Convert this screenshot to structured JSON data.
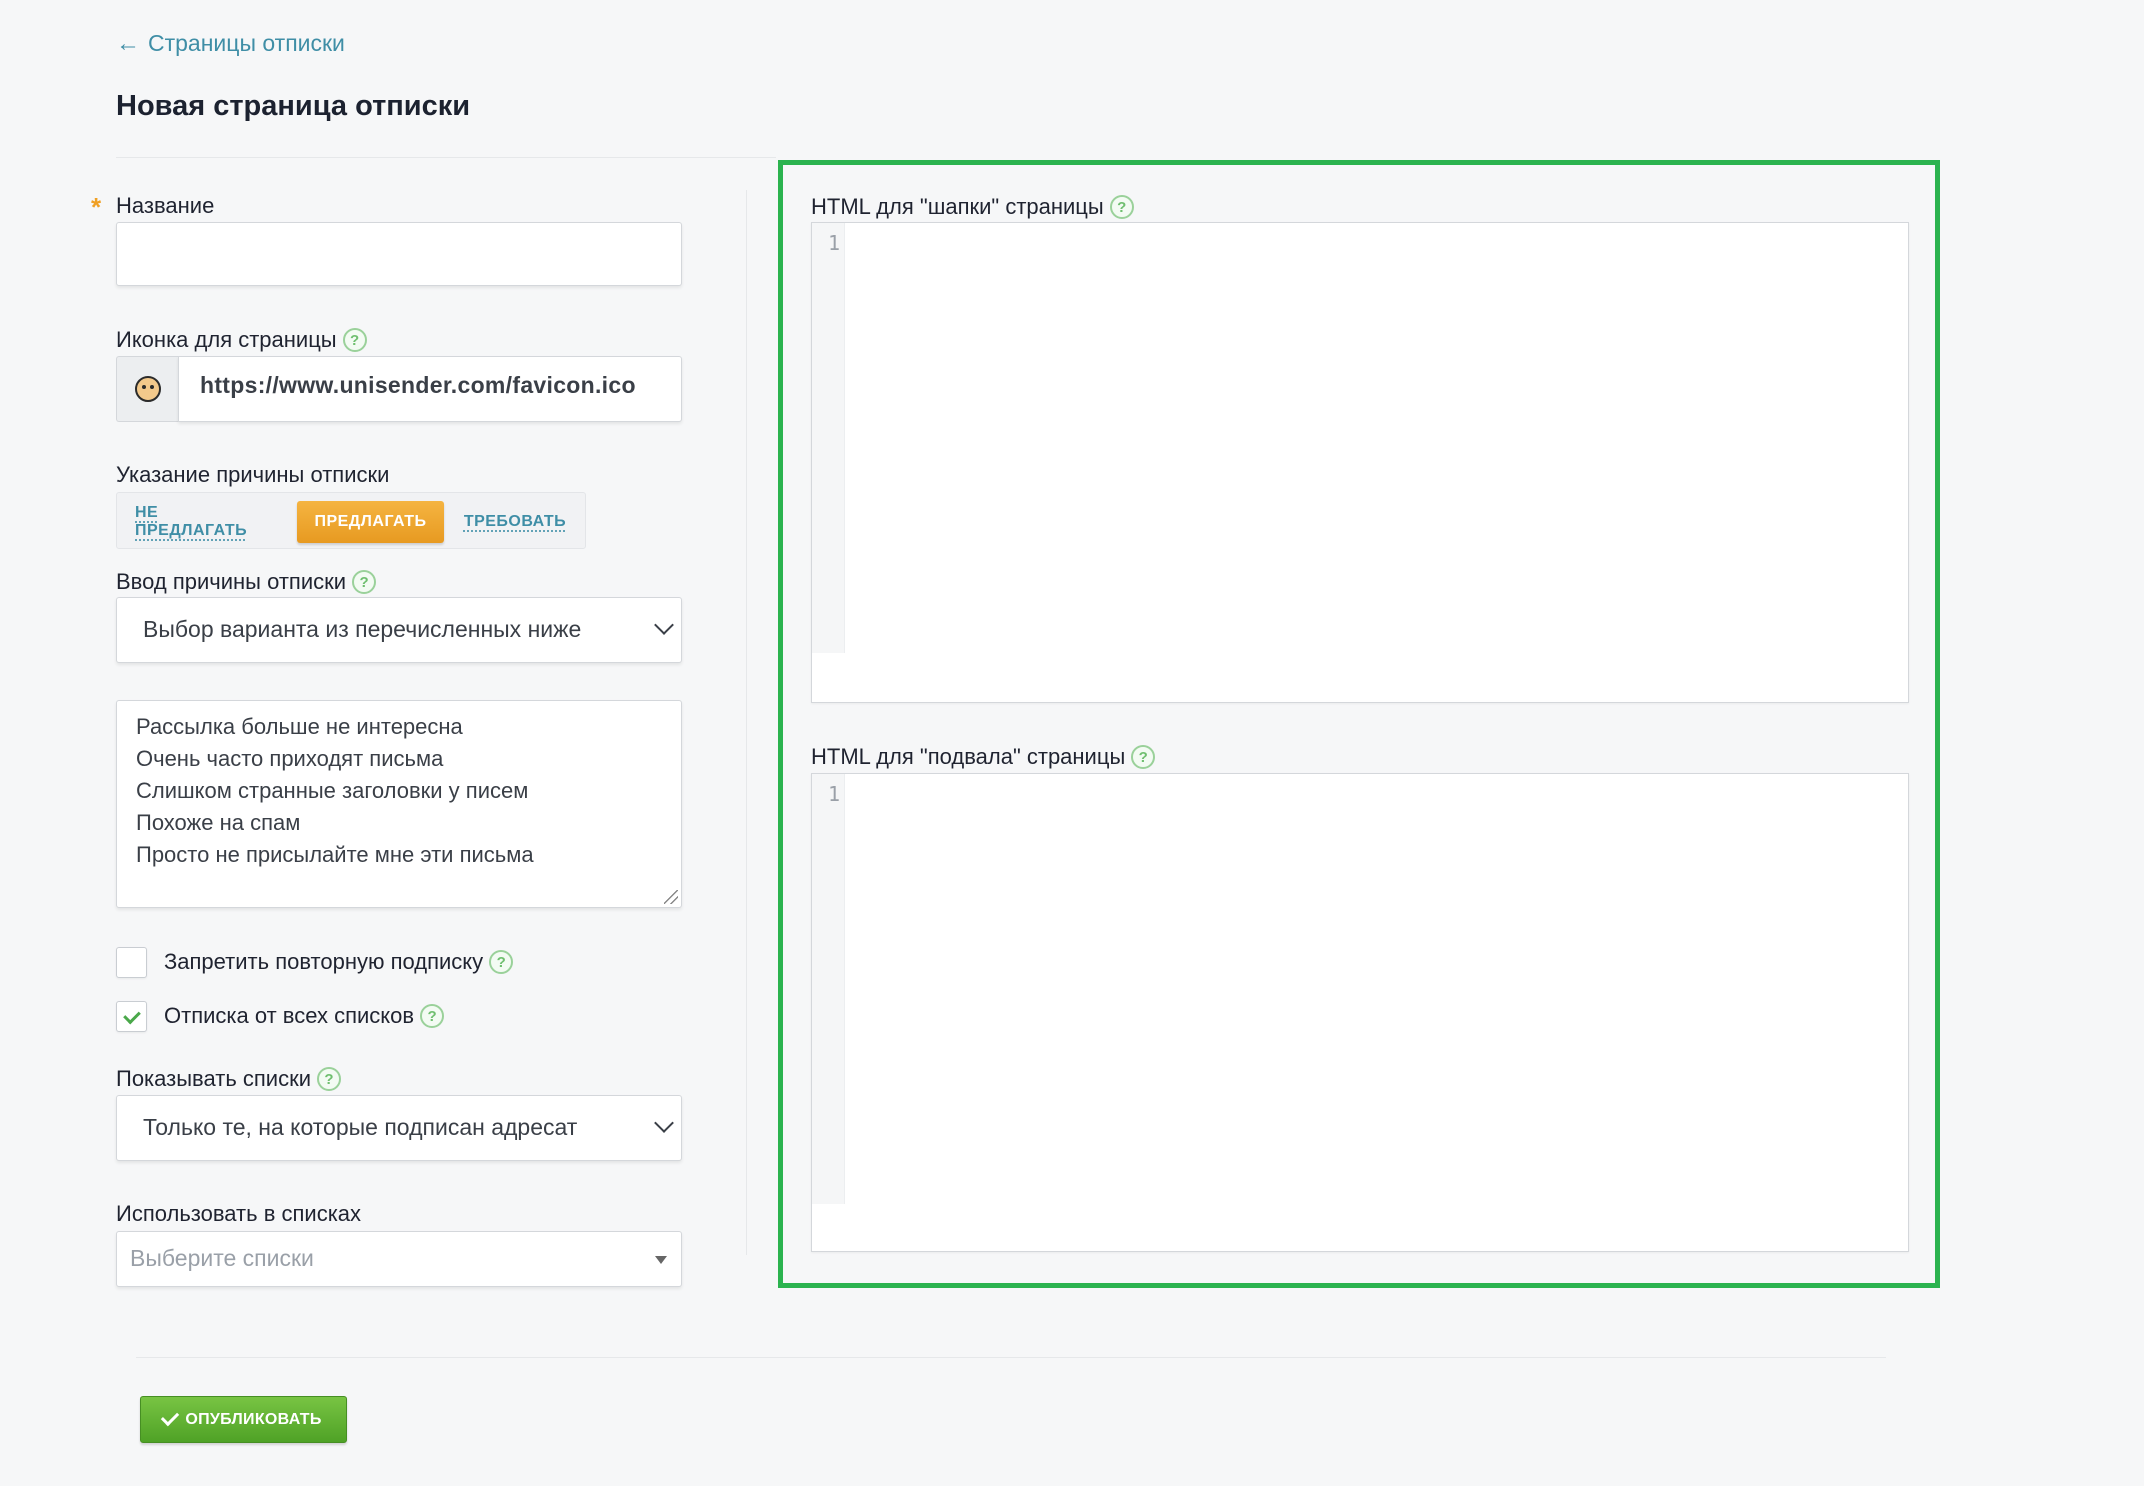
{
  "nav": {
    "back_arrow": "←",
    "back_label": "Страницы отписки"
  },
  "page": {
    "title": "Новая страница отписки"
  },
  "form": {
    "name": {
      "label": "Название",
      "required_mark": "*",
      "value": ""
    },
    "icon": {
      "label": "Иконка для страницы",
      "help": "?",
      "value": "https://www.unisender.com/favicon.ico",
      "preview_icon": "favicon-icon"
    },
    "reason": {
      "label": "Указание причины отписки",
      "options": [
        "НЕ ПРЕДЛАГАТЬ",
        "ПРЕДЛАГАТЬ",
        "ТРЕБОВАТЬ"
      ],
      "selected": "ПРЕДЛАГАТЬ"
    },
    "reason_input": {
      "label": "Ввод причины отписки",
      "help": "?",
      "selected": "Выбор варианта из перечисленных ниже"
    },
    "reasons_list": [
      "Рассылка больше не интересна",
      "Очень часто приходят письма",
      "Слишком странные заголовки у писем",
      "Похоже на спам",
      "Просто не присылайте мне эти письма"
    ],
    "forbid_resubscribe": {
      "label": "Запретить повторную подписку",
      "help": "?",
      "checked": false
    },
    "unsubscribe_all": {
      "label": "Отписка от всех списков",
      "help": "?",
      "checked": true
    },
    "show_lists": {
      "label": "Показывать списки",
      "help": "?",
      "selected": "Только те, на которые подписан адресат"
    },
    "use_in_lists": {
      "label": "Использовать в списках",
      "placeholder": "Выберите списки"
    }
  },
  "editors": {
    "header": {
      "label": "HTML для \"шапки\" страницы",
      "help": "?",
      "line_number": "1"
    },
    "footer": {
      "label": "HTML для \"подвала\" страницы",
      "help": "?",
      "line_number": "1"
    }
  },
  "actions": {
    "publish_label": "ОПУБЛИКОВАТЬ"
  },
  "colors": {
    "accent_orange": "#e79a21",
    "link_teal": "#3f8ea6",
    "highlight_green": "#2bb34f",
    "publish_green": "#4fa226"
  }
}
